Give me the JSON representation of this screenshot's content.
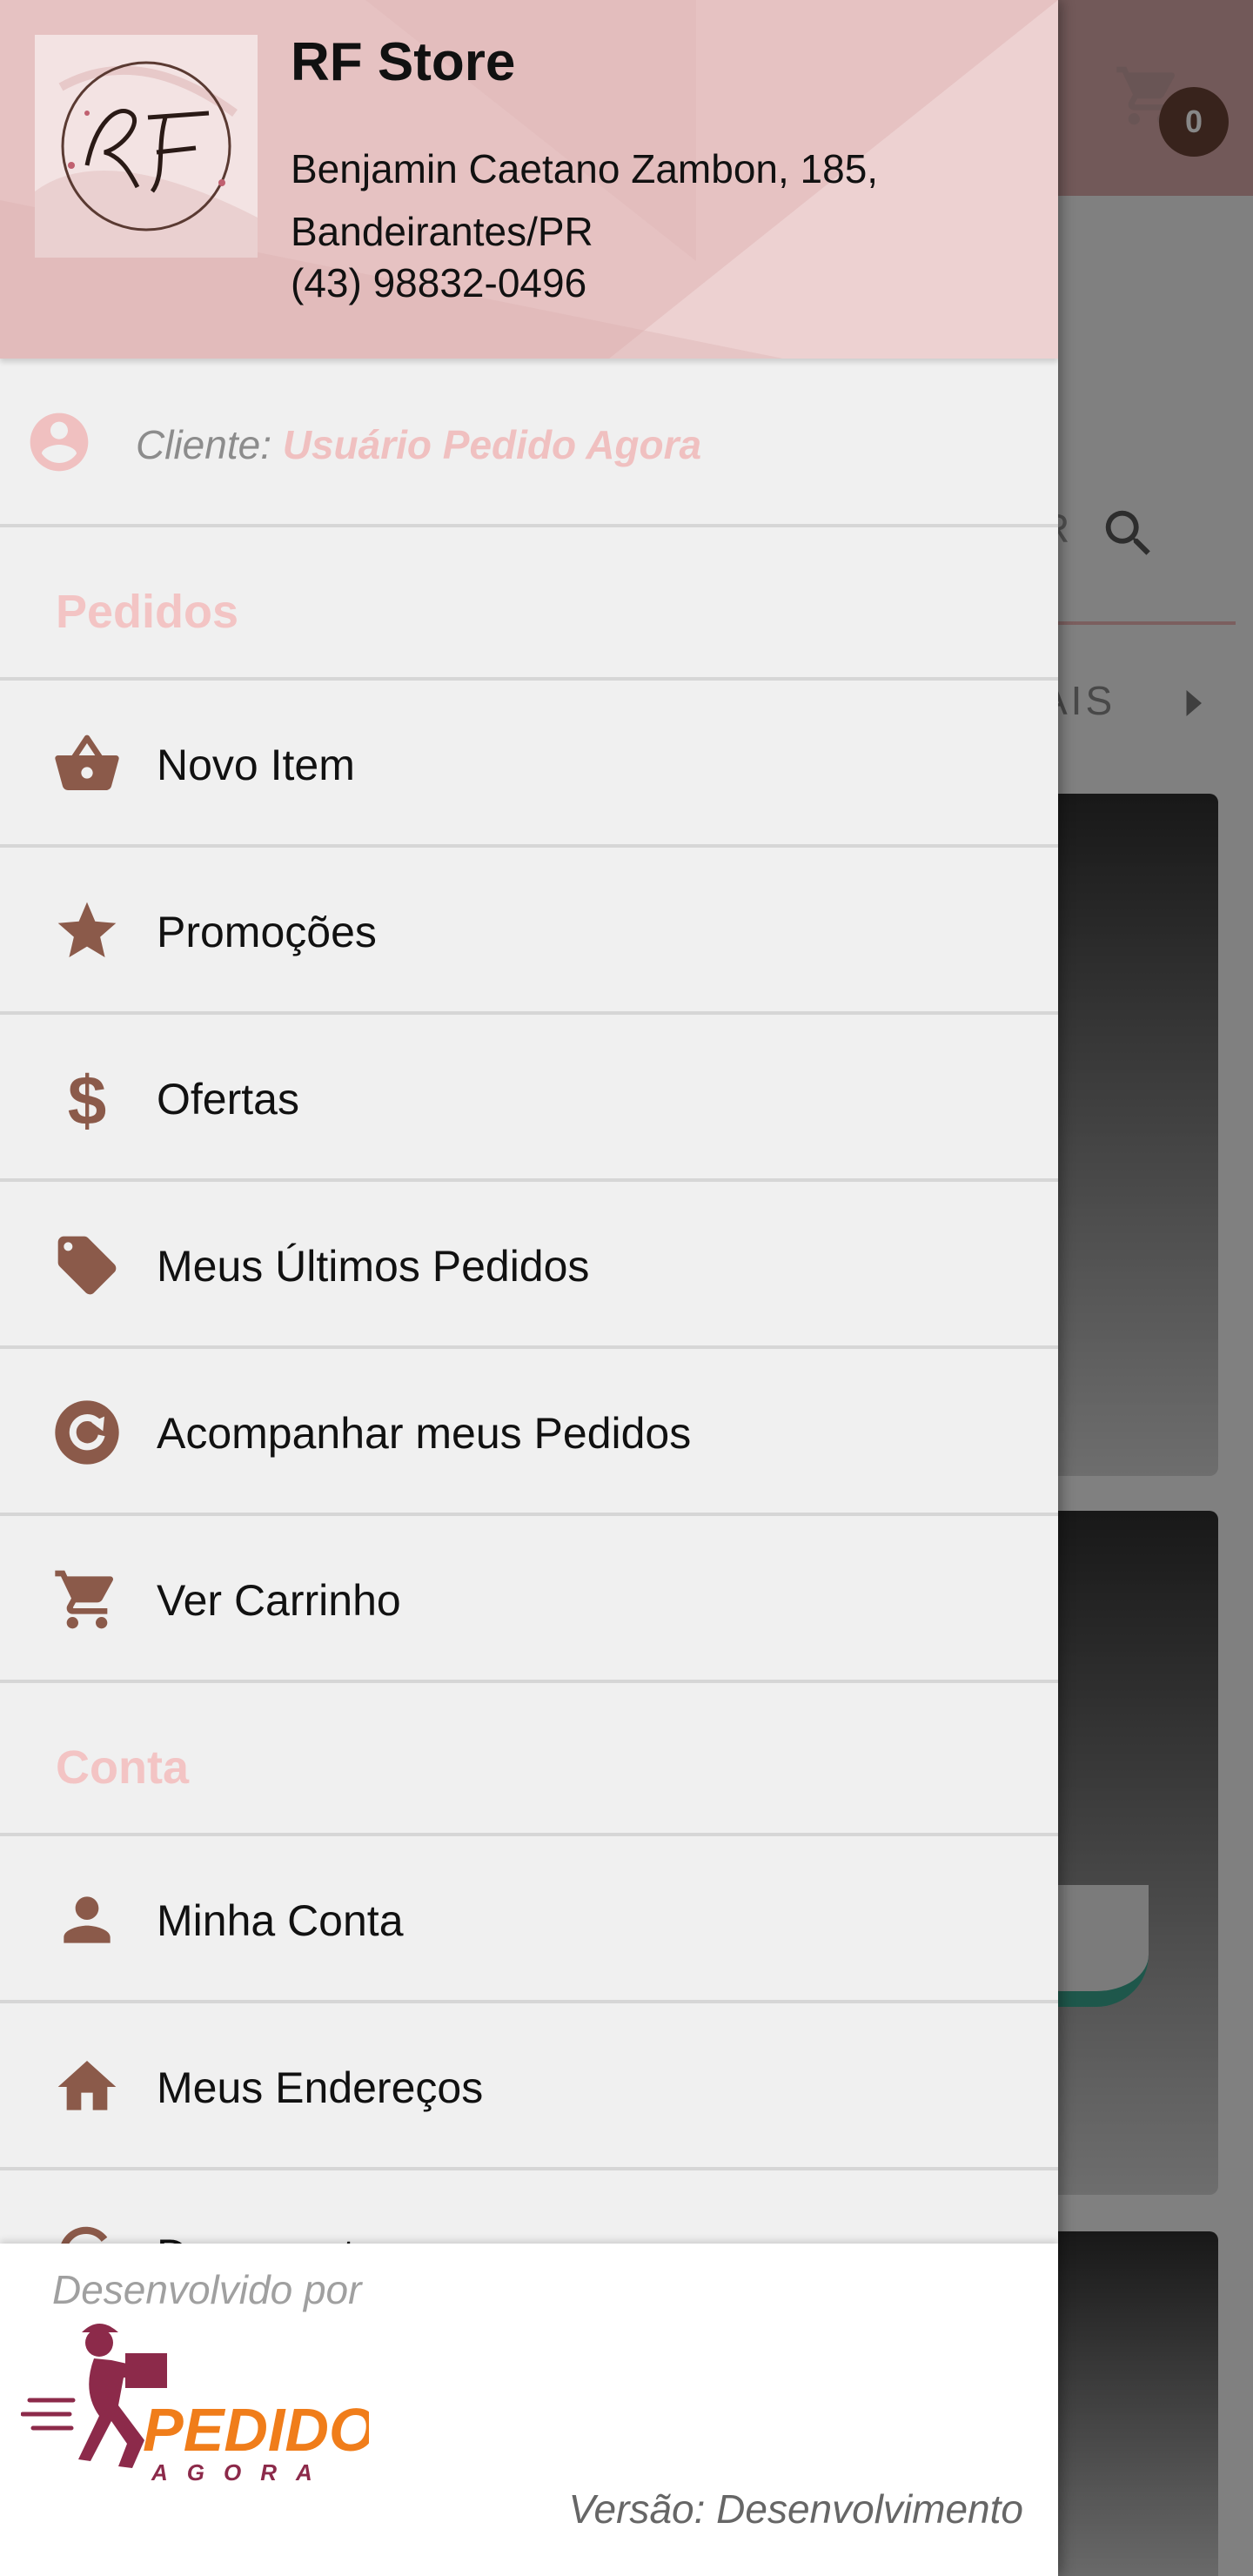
{
  "background": {
    "cart_badge_count": "0",
    "search_text": "R",
    "category_text": "AIS"
  },
  "drawer": {
    "store": {
      "logo_name": "rf-store-logo",
      "name": "RF Store",
      "address": "Benjamin Caetano Zambon, 185, Bandeirantes/PR",
      "phone": "(43) 98832-0496"
    },
    "client": {
      "label": "Cliente:",
      "name": "Usuário Pedido Agora"
    },
    "sections": [
      {
        "title": "Pedidos",
        "items": [
          {
            "label": "Novo Item",
            "icon": "basket-icon"
          },
          {
            "label": "Promoções",
            "icon": "star-icon"
          },
          {
            "label": "Ofertas",
            "icon": "dollar-icon"
          },
          {
            "label": "Meus Últimos Pedidos",
            "icon": "tags-icon"
          },
          {
            "label": "Acompanhar meus Pedidos",
            "icon": "refresh-icon"
          },
          {
            "label": "Ver Carrinho",
            "icon": "cart-icon"
          }
        ]
      },
      {
        "title": "Conta",
        "items": [
          {
            "label": "Minha Conta",
            "icon": "person-icon"
          },
          {
            "label": "Meus Endereços",
            "icon": "home-icon"
          },
          {
            "label": "Documentos",
            "icon": "document-icon"
          }
        ]
      }
    ],
    "footer": {
      "developed_by": "Desenvolvido por",
      "brand_top": "PEDIDO",
      "brand_bottom": "AGORA",
      "version": "Versão: Desenvolvimento"
    }
  },
  "colors": {
    "header_bg": "#e6c2c2",
    "accent_pink": "#f3c4c4",
    "icon_brown": "#8b5a4a",
    "brand_orange": "#f07d1a",
    "brand_maroon": "#8c2a4a"
  }
}
